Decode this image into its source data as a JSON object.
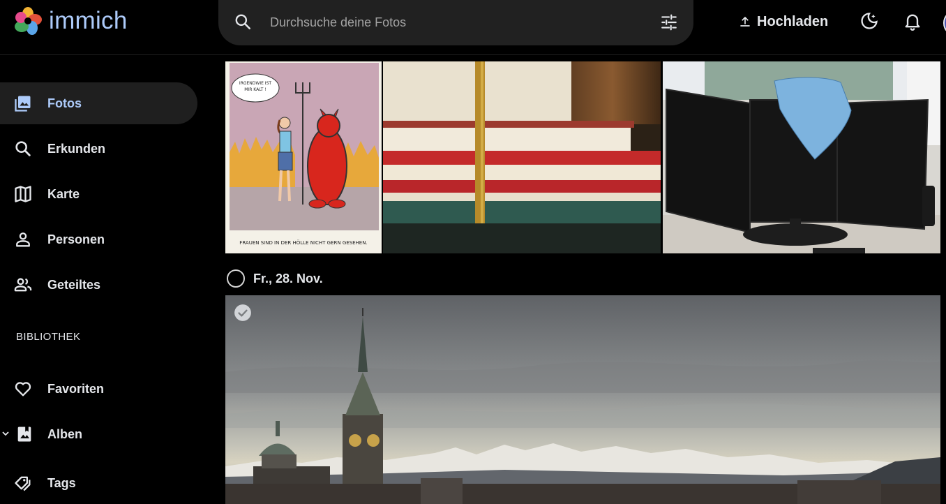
{
  "app": {
    "name": "immich"
  },
  "header": {
    "search_placeholder": "Durchsuche deine Fotos",
    "upload_label": "Hochladen"
  },
  "sidebar": {
    "items": [
      {
        "label": "Fotos",
        "icon": "photos-icon",
        "active": true
      },
      {
        "label": "Erkunden",
        "icon": "search-icon"
      },
      {
        "label": "Karte",
        "icon": "map-icon"
      },
      {
        "label": "Personen",
        "icon": "person-icon"
      },
      {
        "label": "Geteiltes",
        "icon": "shared-icon"
      }
    ],
    "library_section": "BIBLIOTHEK",
    "library_items": [
      {
        "label": "Favoriten",
        "icon": "heart-icon"
      },
      {
        "label": "Alben",
        "icon": "album-icon"
      },
      {
        "label": "Tags",
        "icon": "tag-icon"
      }
    ]
  },
  "timeline": {
    "cartoon_caption_top": "IRGENDWIE IST MIR KALT !",
    "cartoon_caption_bottom": "FRAUEN SIND IN DER HÖLLE NICHT GERN GESEHEN.",
    "date_group": "Fr., 28. Nov."
  },
  "colors": {
    "accent": "#adcbfa",
    "active_bg": "#1f1f1f",
    "search_bg": "#212121"
  }
}
